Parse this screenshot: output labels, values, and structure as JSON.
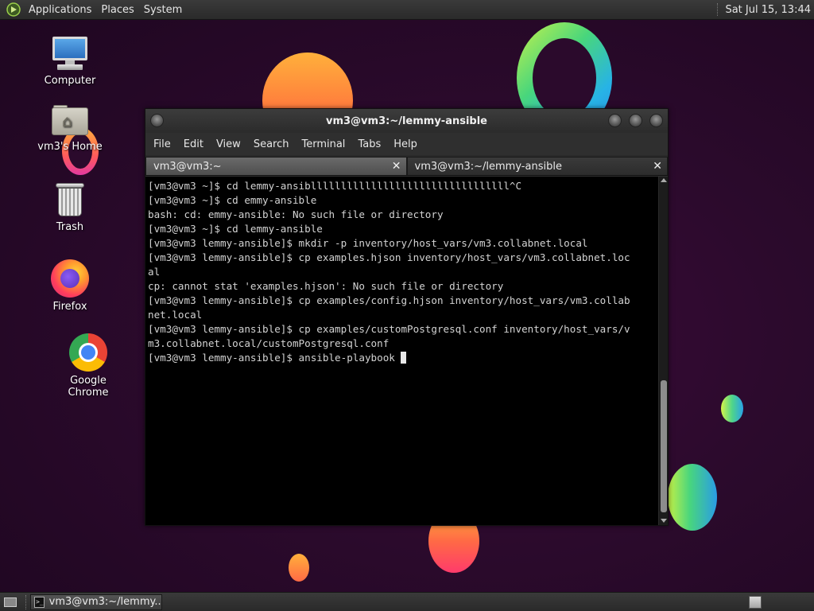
{
  "top_panel": {
    "menus": [
      "Applications",
      "Places",
      "System"
    ],
    "clock": "Sat Jul 15, 13:44"
  },
  "desktop_icons": [
    {
      "label": "Computer",
      "icon": "computer-icon"
    },
    {
      "label": "vm3's Home",
      "icon": "home-folder-icon"
    },
    {
      "label": "Trash",
      "icon": "trash-icon"
    },
    {
      "label": "Firefox",
      "icon": "firefox-icon"
    },
    {
      "label": "Google Chrome",
      "icon": "chrome-icon"
    }
  ],
  "terminal": {
    "title": "vm3@vm3:~/lemmy-ansible",
    "menu": [
      "File",
      "Edit",
      "View",
      "Search",
      "Terminal",
      "Tabs",
      "Help"
    ],
    "tabs": [
      {
        "label": "vm3@vm3:~",
        "active": false
      },
      {
        "label": "vm3@vm3:~/lemmy-ansible",
        "active": true
      }
    ],
    "lines": [
      "[vm3@vm3 ~]$ cd lemmy-ansiblllllllllllllllllllllllllllllllll^C",
      "[vm3@vm3 ~]$ cd emmy-ansible",
      "bash: cd: emmy-ansible: No such file or directory",
      "[vm3@vm3 ~]$ cd lemmy-ansible",
      "[vm3@vm3 lemmy-ansible]$ mkdir -p inventory/host_vars/vm3.collabnet.local",
      "[vm3@vm3 lemmy-ansible]$ cp examples.hjson inventory/host_vars/vm3.collabnet.loc",
      "al",
      "cp: cannot stat 'examples.hjson': No such file or directory",
      "[vm3@vm3 lemmy-ansible]$ cp examples/config.hjson inventory/host_vars/vm3.collab",
      "net.local",
      "[vm3@vm3 lemmy-ansible]$ cp examples/customPostgresql.conf inventory/host_vars/v",
      "m3.collabnet.local/customPostgresql.conf",
      "[vm3@vm3 lemmy-ansible]$ ansible-playbook "
    ]
  },
  "taskbar": {
    "task_label": "vm3@vm3:~/lemmy..."
  }
}
